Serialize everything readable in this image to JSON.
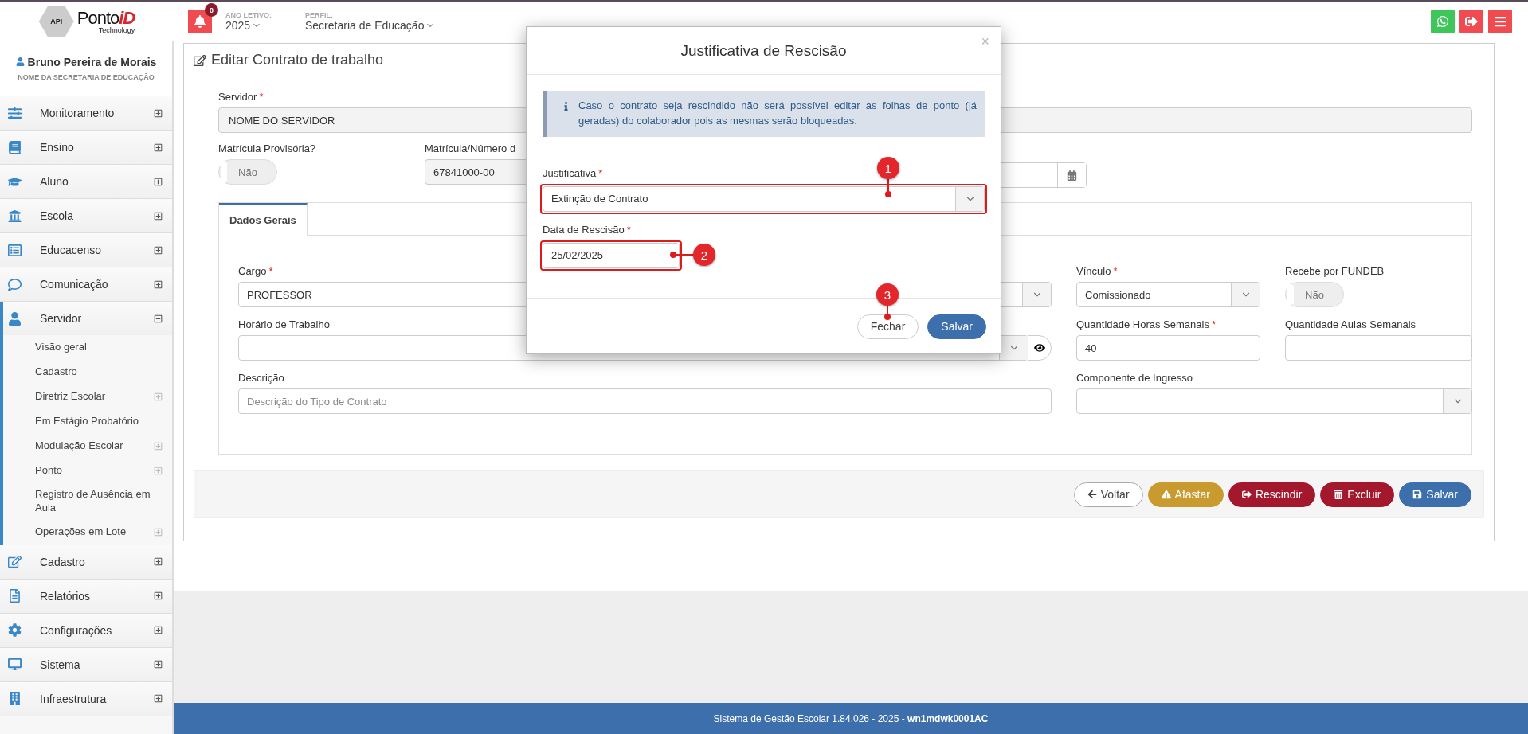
{
  "header": {
    "logo": {
      "badge": "API",
      "brand": "Ponto",
      "brand_accent": "iD",
      "tagline": "Technology"
    },
    "notifications": {
      "count": "0"
    },
    "year": {
      "label": "ANO LETIVO:",
      "value": "2025"
    },
    "profile": {
      "label": "PERFIL:",
      "value": "Secretaria de Educação"
    }
  },
  "sidebar": {
    "user": {
      "name": "Bruno Pereira de Morais",
      "org": "NOME DA SECRETARIA DE EDUCAÇÃO"
    },
    "items": [
      {
        "label": "Monitoramento",
        "expanded": false
      },
      {
        "label": "Ensino",
        "expanded": false
      },
      {
        "label": "Aluno",
        "expanded": false
      },
      {
        "label": "Escola",
        "expanded": false
      },
      {
        "label": "Educacenso",
        "expanded": false
      },
      {
        "label": "Comunicação",
        "expanded": false
      },
      {
        "label": "Servidor",
        "expanded": true,
        "children": [
          {
            "label": "Visão geral",
            "expandable": false
          },
          {
            "label": "Cadastro",
            "expandable": false
          },
          {
            "label": "Diretriz Escolar",
            "expandable": true
          },
          {
            "label": "Em Estágio Probatório",
            "expandable": false
          },
          {
            "label": "Modulação Escolar",
            "expandable": true
          },
          {
            "label": "Ponto",
            "expandable": true
          },
          {
            "label": "Registro de Ausência em Aula",
            "expandable": false
          },
          {
            "label": "Operações em Lote",
            "expandable": true
          }
        ]
      },
      {
        "label": "Cadastro",
        "expanded": false
      },
      {
        "label": "Relatórios",
        "expanded": false
      },
      {
        "label": "Configurações",
        "expanded": false
      },
      {
        "label": "Sistema",
        "expanded": false
      },
      {
        "label": "Infraestrutura",
        "expanded": false
      }
    ]
  },
  "form": {
    "title": "Editar Contrato de trabalho",
    "servidor": {
      "label": "Servidor",
      "required": "*",
      "value": "NOME DO SERVIDOR"
    },
    "matricula_provisoria": {
      "label": "Matrícula Provisória?",
      "toggle": {
        "on": false,
        "text": "Não"
      }
    },
    "matricula": {
      "label": "Matrícula/Número d",
      "value": "67841000-00"
    },
    "tabs": [
      {
        "label": "Dados Gerais",
        "selected": true
      }
    ],
    "rows": [
      [
        {
          "kind": "select",
          "label": "Cargo",
          "required": "*",
          "value": "PROFESSOR"
        },
        {
          "kind": "select",
          "label": "Vínculo",
          "required": "*",
          "value": "Comissionado"
        },
        {
          "kind": "toggle",
          "label": "Recebe por FUNDEB",
          "on": false,
          "text": "Não"
        }
      ],
      [
        {
          "kind": "select_view",
          "label": "Horário de Trabalho"
        },
        {
          "kind": "input",
          "label": "Quantidade Horas Semanais",
          "required": "*",
          "value": "40"
        },
        {
          "kind": "input",
          "label": "Quantidade Aulas Semanais"
        }
      ],
      [
        {
          "kind": "input",
          "label": "Descrição",
          "placeholder": "Descrição do Tipo de Contrato"
        },
        {
          "kind": "select",
          "label": "Componente de Ingresso"
        }
      ]
    ],
    "actions": [
      {
        "kind": "back",
        "label": "Voltar"
      },
      {
        "kind": "warning",
        "label": "Afastar"
      },
      {
        "kind": "terminate",
        "label": "Rescindir"
      },
      {
        "kind": "delete",
        "label": "Excluir"
      },
      {
        "kind": "save",
        "label": "Salvar"
      }
    ]
  },
  "modal": {
    "title": "Justificativa de Rescisão",
    "close": "×",
    "info": "Caso o contrato seja rescindido não será possível editar as folhas de ponto (já geradas) do colaborador pois as mesmas serão bloqueadas.",
    "justificativa": {
      "label": "Justificativa",
      "required": "*",
      "value": "Extinção de Contrato"
    },
    "data": {
      "label": "Data de Rescisão",
      "required": "*",
      "value": "25/02/2025"
    },
    "buttons": [
      {
        "kind": "close",
        "label": "Fechar"
      },
      {
        "kind": "save",
        "label": "Salvar"
      }
    ],
    "annotations": [
      {
        "number": "1"
      },
      {
        "number": "2"
      },
      {
        "number": "3"
      }
    ]
  },
  "footer": {
    "text": "Sistema de Gestão Escolar 1.84.026 - 2025 - **wn1mdwk0001AC**"
  }
}
